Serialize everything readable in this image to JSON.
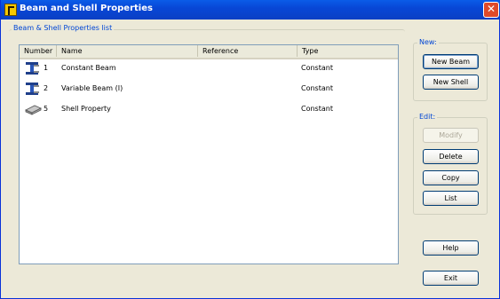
{
  "window": {
    "title": "Beam and Shell Properties",
    "close_label": "✕"
  },
  "list_group": {
    "label": "Beam & Shell Properties list"
  },
  "columns": [
    "Number",
    "Name",
    "Reference",
    "Type"
  ],
  "rows": [
    {
      "number": "1",
      "name": "Constant Beam",
      "reference": "",
      "type": "Constant",
      "icon": "ibeam-icon"
    },
    {
      "number": "2",
      "name": "Variable Beam (I)",
      "reference": "",
      "type": "Constant",
      "icon": "ibeam-icon"
    },
    {
      "number": "5",
      "name": "Shell Property",
      "reference": "",
      "type": "Constant",
      "icon": "shell-plate-icon"
    }
  ],
  "new_group": {
    "label": "New:",
    "new_beam": "New Beam",
    "new_shell": "New Shell"
  },
  "edit_group": {
    "label": "Edit:",
    "modify": "Modify",
    "delete": "Delete",
    "copy": "Copy",
    "list": "List"
  },
  "help": "Help",
  "exit": "Exit",
  "colors": {
    "titlebar": "#0a5ce8",
    "face": "#ece9d8",
    "group_label": "#0046d5"
  }
}
